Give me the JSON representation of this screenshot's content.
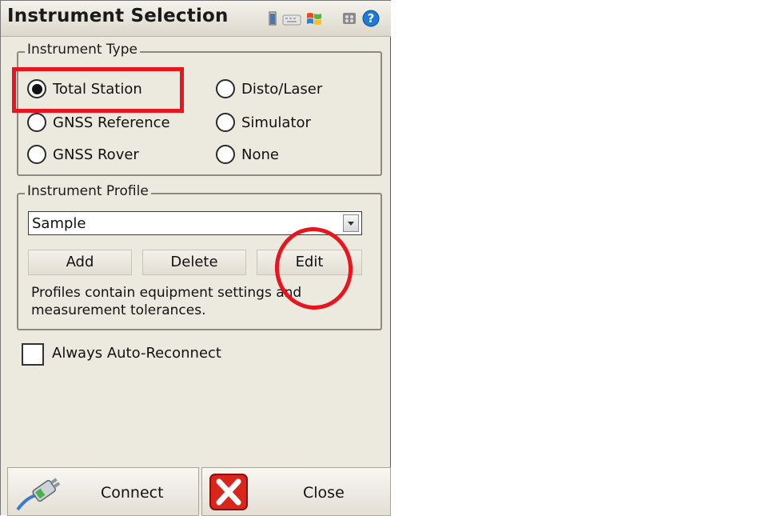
{
  "window": {
    "title": "Instrument Selection",
    "toolbar_icons": [
      "battery-icon",
      "keyboard-icon",
      "windows-flag-icon",
      "settings-icon",
      "help-icon"
    ]
  },
  "instrument_type": {
    "legend": "Instrument Type",
    "options": [
      {
        "label": "Total Station",
        "selected": true
      },
      {
        "label": "Disto/Laser",
        "selected": false
      },
      {
        "label": "GNSS Reference",
        "selected": false
      },
      {
        "label": "Simulator",
        "selected": false
      },
      {
        "label": "GNSS Rover",
        "selected": false
      },
      {
        "label": "None",
        "selected": false
      }
    ]
  },
  "instrument_profile": {
    "legend": "Instrument Profile",
    "selected_value": "Sample",
    "buttons": {
      "add": "Add",
      "delete": "Delete",
      "edit": "Edit"
    },
    "description": "Profiles contain equipment settings and measurement tolerances."
  },
  "auto_reconnect": {
    "label": "Always Auto-Reconnect",
    "checked": false
  },
  "footer": {
    "connect": "Connect",
    "close": "Close"
  },
  "colors": {
    "annotation": "#e8141e",
    "panel": "#ece9df"
  }
}
